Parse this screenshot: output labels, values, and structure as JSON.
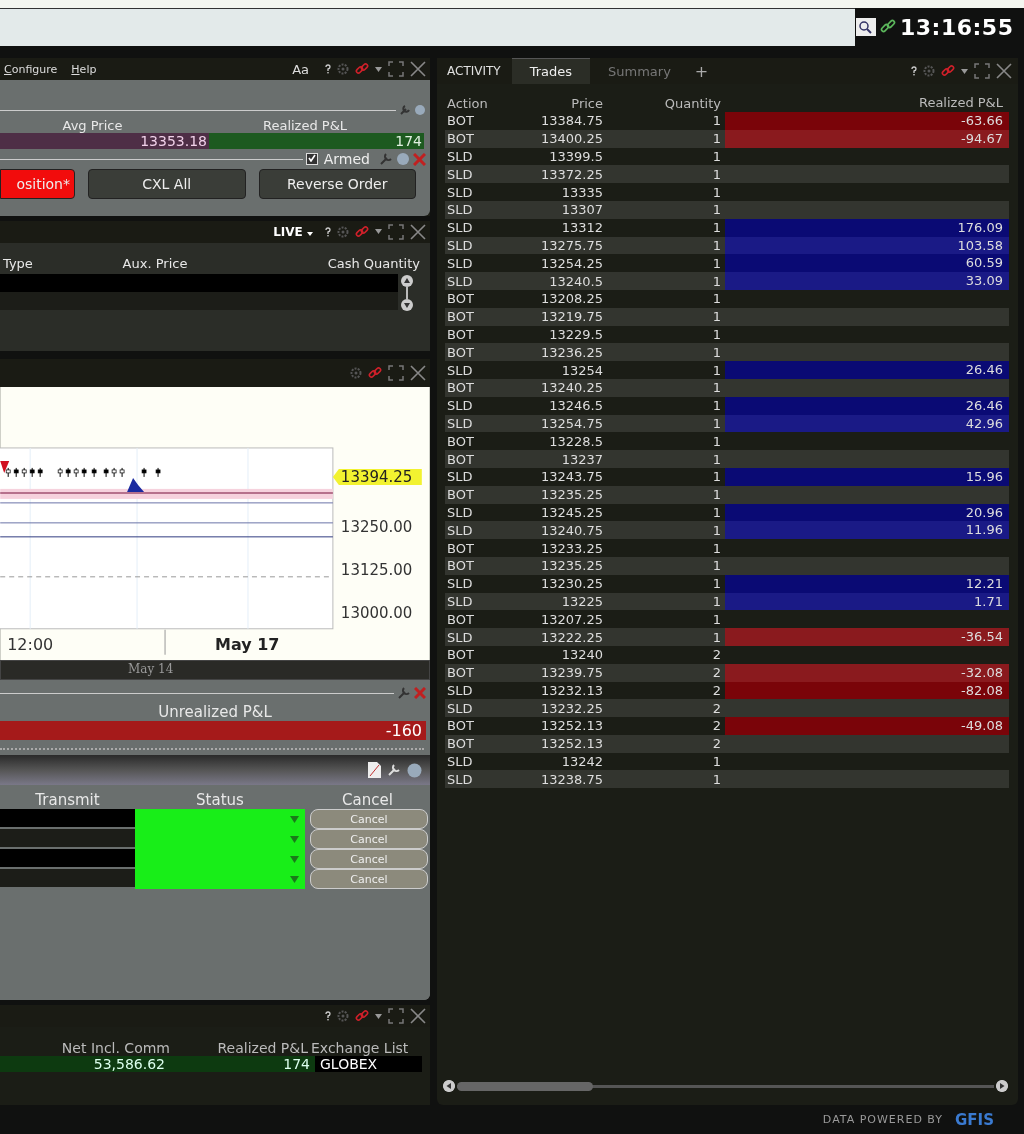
{
  "top_bar": {
    "clock": "13:16:55"
  },
  "position_panel": {
    "menu": [
      {
        "label": "Configure"
      },
      {
        "label": "Help"
      }
    ],
    "font_button": "Aa",
    "columns": [
      "Avg Price",
      "Realized P&L"
    ],
    "avg_price": "13353.18",
    "realized_pnl": "174",
    "armed": {
      "label": "Armed",
      "checked": true
    },
    "buttons": [
      {
        "label": "osition*",
        "kind": "danger"
      },
      {
        "label": "CXL All",
        "kind": "normal"
      },
      {
        "label": "Reverse Order",
        "kind": "normal"
      }
    ]
  },
  "orders_panel": {
    "mode": "LIVE",
    "columns": [
      "Type",
      "Aux. Price",
      "Cash Quantity"
    ]
  },
  "chart": {
    "price_label": "13394.25",
    "y_labels": [
      "13250.00",
      "13125.00",
      "13000.00"
    ],
    "x_labels": [
      "12:00",
      "May 17"
    ],
    "scroll_label": "May 14"
  },
  "pnl_panel": {
    "label": "Unrealized P&L",
    "value": "-160"
  },
  "order_status_panel": {
    "columns": [
      "Transmit",
      "Status",
      "Cancel"
    ],
    "rows": [
      {
        "cancel": "Cancel"
      },
      {
        "cancel": "Cancel"
      },
      {
        "cancel": "Cancel"
      },
      {
        "cancel": "Cancel"
      }
    ]
  },
  "account_panel": {
    "columns": [
      "Net Incl. Comm",
      "Realized P&L",
      "Exchange List"
    ],
    "values": [
      "53,586.62",
      "174",
      "GLOBEX"
    ]
  },
  "activity": {
    "title": "ACTIVITY",
    "tabs": [
      {
        "label": "Trades",
        "selected": true
      },
      {
        "label": "Summary",
        "selected": false
      }
    ],
    "add_tab": "+",
    "columns": [
      "Action",
      "Price",
      "Quantity",
      "Realized P&L"
    ],
    "rows": [
      {
        "action": "BOT",
        "price": "13384.75",
        "quantity": "1",
        "pnl": "-63.66",
        "kind": "loss"
      },
      {
        "action": "BOT",
        "price": "13400.25",
        "quantity": "1",
        "pnl": "-94.67",
        "kind": "loss"
      },
      {
        "action": "SLD",
        "price": "13399.5",
        "quantity": "1",
        "pnl": "",
        "kind": "flat"
      },
      {
        "action": "SLD",
        "price": "13372.25",
        "quantity": "1",
        "pnl": "",
        "kind": "flat"
      },
      {
        "action": "SLD",
        "price": "13335",
        "quantity": "1",
        "pnl": "",
        "kind": "flat"
      },
      {
        "action": "SLD",
        "price": "13307",
        "quantity": "1",
        "pnl": "",
        "kind": "flat"
      },
      {
        "action": "SLD",
        "price": "13312",
        "quantity": "1",
        "pnl": "176.09",
        "kind": "gain"
      },
      {
        "action": "SLD",
        "price": "13275.75",
        "quantity": "1",
        "pnl": "103.58",
        "kind": "gain"
      },
      {
        "action": "SLD",
        "price": "13254.25",
        "quantity": "1",
        "pnl": "60.59",
        "kind": "gain"
      },
      {
        "action": "SLD",
        "price": "13240.5",
        "quantity": "1",
        "pnl": "33.09",
        "kind": "gain"
      },
      {
        "action": "BOT",
        "price": "13208.25",
        "quantity": "1",
        "pnl": "",
        "kind": "flat"
      },
      {
        "action": "BOT",
        "price": "13219.75",
        "quantity": "1",
        "pnl": "",
        "kind": "flat"
      },
      {
        "action": "BOT",
        "price": "13229.5",
        "quantity": "1",
        "pnl": "",
        "kind": "flat"
      },
      {
        "action": "BOT",
        "price": "13236.25",
        "quantity": "1",
        "pnl": "",
        "kind": "flat"
      },
      {
        "action": "SLD",
        "price": "13254",
        "quantity": "1",
        "pnl": "26.46",
        "kind": "gain"
      },
      {
        "action": "BOT",
        "price": "13240.25",
        "quantity": "1",
        "pnl": "",
        "kind": "flat"
      },
      {
        "action": "SLD",
        "price": "13246.5",
        "quantity": "1",
        "pnl": "26.46",
        "kind": "gain"
      },
      {
        "action": "SLD",
        "price": "13254.75",
        "quantity": "1",
        "pnl": "42.96",
        "kind": "gain"
      },
      {
        "action": "BOT",
        "price": "13228.5",
        "quantity": "1",
        "pnl": "",
        "kind": "flat"
      },
      {
        "action": "BOT",
        "price": "13237",
        "quantity": "1",
        "pnl": "",
        "kind": "flat"
      },
      {
        "action": "SLD",
        "price": "13243.75",
        "quantity": "1",
        "pnl": "15.96",
        "kind": "gain"
      },
      {
        "action": "BOT",
        "price": "13235.25",
        "quantity": "1",
        "pnl": "",
        "kind": "flat"
      },
      {
        "action": "SLD",
        "price": "13245.25",
        "quantity": "1",
        "pnl": "20.96",
        "kind": "gain"
      },
      {
        "action": "SLD",
        "price": "13240.75",
        "quantity": "1",
        "pnl": "11.96",
        "kind": "gain"
      },
      {
        "action": "BOT",
        "price": "13233.25",
        "quantity": "1",
        "pnl": "",
        "kind": "flat"
      },
      {
        "action": "BOT",
        "price": "13235.25",
        "quantity": "1",
        "pnl": "",
        "kind": "flat"
      },
      {
        "action": "SLD",
        "price": "13230.25",
        "quantity": "1",
        "pnl": "12.21",
        "kind": "gain"
      },
      {
        "action": "SLD",
        "price": "13225",
        "quantity": "1",
        "pnl": "1.71",
        "kind": "gain"
      },
      {
        "action": "BOT",
        "price": "13207.25",
        "quantity": "1",
        "pnl": "",
        "kind": "flat"
      },
      {
        "action": "SLD",
        "price": "13222.25",
        "quantity": "1",
        "pnl": "-36.54",
        "kind": "loss"
      },
      {
        "action": "BOT",
        "price": "13240",
        "quantity": "2",
        "pnl": "",
        "kind": "flat"
      },
      {
        "action": "BOT",
        "price": "13239.75",
        "quantity": "2",
        "pnl": "-32.08",
        "kind": "loss"
      },
      {
        "action": "SLD",
        "price": "13232.13",
        "quantity": "2",
        "pnl": "-82.08",
        "kind": "loss"
      },
      {
        "action": "SLD",
        "price": "13232.25",
        "quantity": "2",
        "pnl": "",
        "kind": "flat"
      },
      {
        "action": "BOT",
        "price": "13252.13",
        "quantity": "2",
        "pnl": "-49.08",
        "kind": "loss"
      },
      {
        "action": "BOT",
        "price": "13252.13",
        "quantity": "2",
        "pnl": "",
        "kind": "flat"
      },
      {
        "action": "SLD",
        "price": "13242",
        "quantity": "1",
        "pnl": "",
        "kind": "flat"
      },
      {
        "action": "SLD",
        "price": "13238.75",
        "quantity": "1",
        "pnl": "",
        "kind": "flat"
      }
    ]
  },
  "footer": {
    "text": "DATA POWERED BY",
    "logo": "GFIS"
  }
}
